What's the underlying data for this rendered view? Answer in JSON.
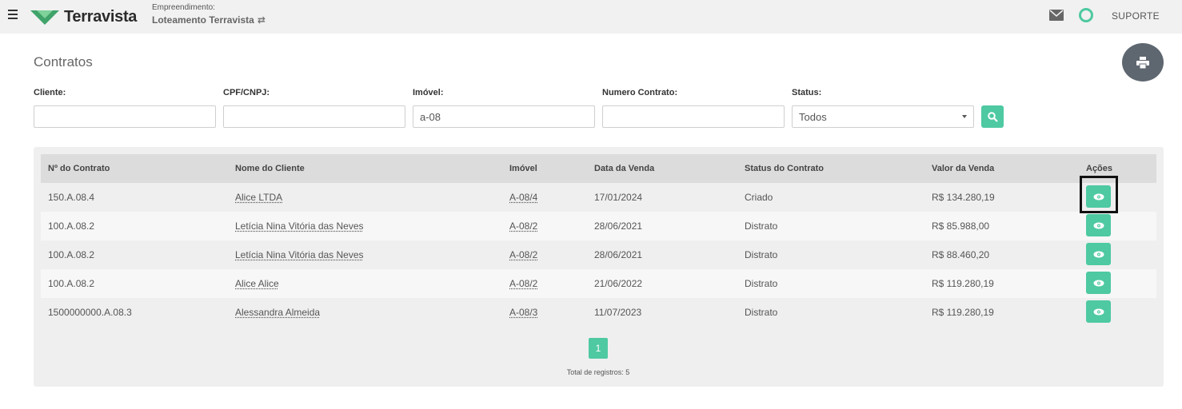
{
  "topbar": {
    "brand": "Terravista",
    "empreendimento_label": "Empreendimento:",
    "empreendimento_name": "Loteamento Terravista",
    "support_label": "SUPORTE"
  },
  "page": {
    "title": "Contratos"
  },
  "filters": {
    "cliente": {
      "label": "Cliente:",
      "value": ""
    },
    "cpf": {
      "label": "CPF/CNPJ:",
      "value": ""
    },
    "imovel": {
      "label": "Imóvel:",
      "value": "a-08"
    },
    "numero": {
      "label": "Numero Contrato:",
      "value": ""
    },
    "status": {
      "label": "Status:",
      "value": "Todos"
    }
  },
  "table": {
    "headers": [
      "Nº do Contrato",
      "Nome do Cliente",
      "Imóvel",
      "Data da Venda",
      "Status do Contrato",
      "Valor da Venda",
      "Ações"
    ],
    "rows": [
      {
        "contrato": "150.A.08.4",
        "cliente": "Alice LTDA",
        "imovel": "A-08/4",
        "data": "17/01/2024",
        "status": "Criado",
        "valor": "R$ 134.280,19"
      },
      {
        "contrato": "100.A.08.2",
        "cliente": "Letícia Nina Vitória das Neves",
        "imovel": "A-08/2",
        "data": "28/06/2021",
        "status": "Distrato",
        "valor": "R$ 85.988,00"
      },
      {
        "contrato": "100.A.08.2",
        "cliente": "Letícia Nina Vitória das Neves",
        "imovel": "A-08/2",
        "data": "28/06/2021",
        "status": "Distrato",
        "valor": "R$ 88.460,20"
      },
      {
        "contrato": "100.A.08.2",
        "cliente": "Alice Alice",
        "imovel": "A-08/2",
        "data": "21/06/2022",
        "status": "Distrato",
        "valor": "R$ 119.280,19"
      },
      {
        "contrato": "1500000000.A.08.3",
        "cliente": "Alessandra Almeida",
        "imovel": "A-08/3",
        "data": "11/07/2023",
        "status": "Distrato",
        "valor": "R$ 119.280,19"
      }
    ]
  },
  "pagination": {
    "current_page": "1",
    "total_label": "Total de registros: 5"
  },
  "colors": {
    "accent": "#4ec9a2",
    "print_button": "#5e6770"
  }
}
